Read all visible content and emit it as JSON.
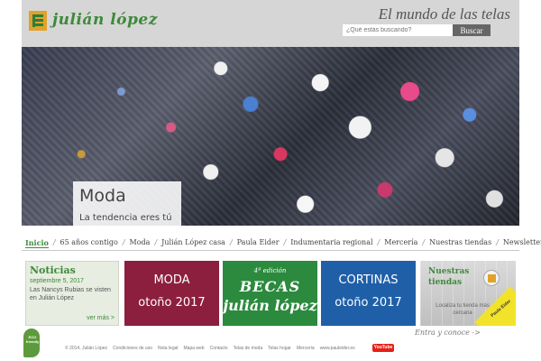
{
  "header": {
    "logo_text": "julián lópez",
    "tagline": "El mundo de las telas",
    "search_placeholder": "¿Qué estás buscando?",
    "search_button": "Buscar"
  },
  "hero": {
    "title": "Moda",
    "subtitle": "La tendencia eres tú"
  },
  "nav": {
    "items": [
      {
        "label": "Inicio"
      },
      {
        "label": "65 años contigo"
      },
      {
        "label": "Moda"
      },
      {
        "label": "Julián López casa"
      },
      {
        "label": "Paula Eider"
      },
      {
        "label": "Indumentaria regional"
      },
      {
        "label": "Mercería"
      },
      {
        "label": "Nuestras tiendas"
      },
      {
        "label": "Newsletter"
      }
    ],
    "separator": "/"
  },
  "noticias": {
    "title": "Noticias",
    "date": "septiembre 5, 2017",
    "text": "Las Nancys Rubias se visten en Julián López",
    "more": "ver más >"
  },
  "tiles": {
    "moda": {
      "line1": "MODA",
      "line2": "otoño 2017"
    },
    "becas": {
      "line1": "4ª edición",
      "line2": "BECAS",
      "line3": "julián lópez"
    },
    "cortinas": {
      "line1": "CORTINAS",
      "line2": "otoño 2017"
    }
  },
  "tiendas": {
    "title_line1": "Nuestras",
    "title_line2": "tiendas",
    "text": "Localiza tu tienda más cercana",
    "corner": "Paula Eider",
    "entra": "Entra y conoce ->"
  },
  "footer": {
    "eco": "ECO friendly",
    "links": [
      "© 2014, Julián López",
      "Condiciones de uso",
      "Nota legal",
      "Mapa web",
      "Contacto",
      "Telas de moda",
      "Telas hogar",
      "Mercería",
      "www.pauleider.es"
    ],
    "youtube": "YouTube"
  },
  "colors": {
    "brand_green": "#3d8a3a",
    "brand_orange": "#e2a229",
    "moda_tile": "#8c1e3e",
    "becas_tile": "#2c8a3e",
    "cortinas_tile": "#1f5fa8"
  }
}
